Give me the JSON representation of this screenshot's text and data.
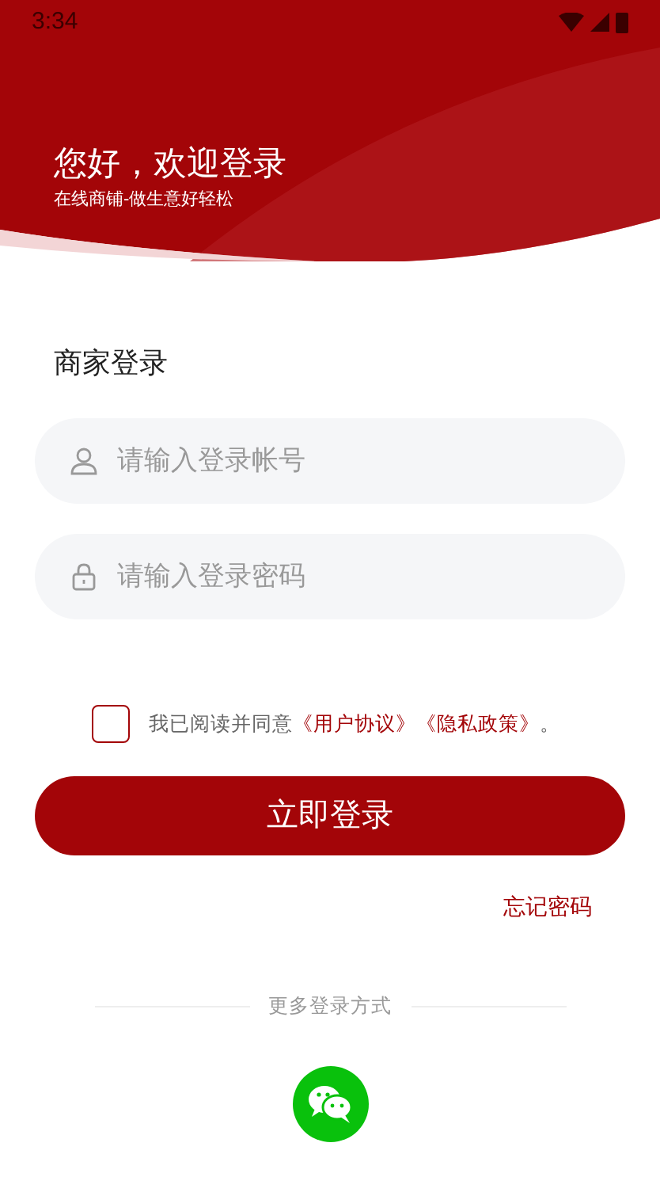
{
  "status_bar": {
    "time": "3:34"
  },
  "header": {
    "title": "您好，欢迎登录",
    "subtitle": "在线商铺-做生意好轻松"
  },
  "form": {
    "heading": "商家登录",
    "fields": [
      {
        "kind": "account",
        "placeholder": "请输入登录帐号"
      },
      {
        "kind": "password",
        "placeholder": "请输入登录密码"
      }
    ],
    "agreement": {
      "checked": false,
      "text": "我已阅读并同意",
      "links": [
        "《用户协议》",
        "《隐私政策》"
      ],
      "end": "。"
    },
    "submit": "立即登录",
    "forgot": "忘记密码"
  },
  "more": {
    "label": "更多登录方式",
    "methods": [
      {
        "kind": "wechat"
      }
    ]
  }
}
